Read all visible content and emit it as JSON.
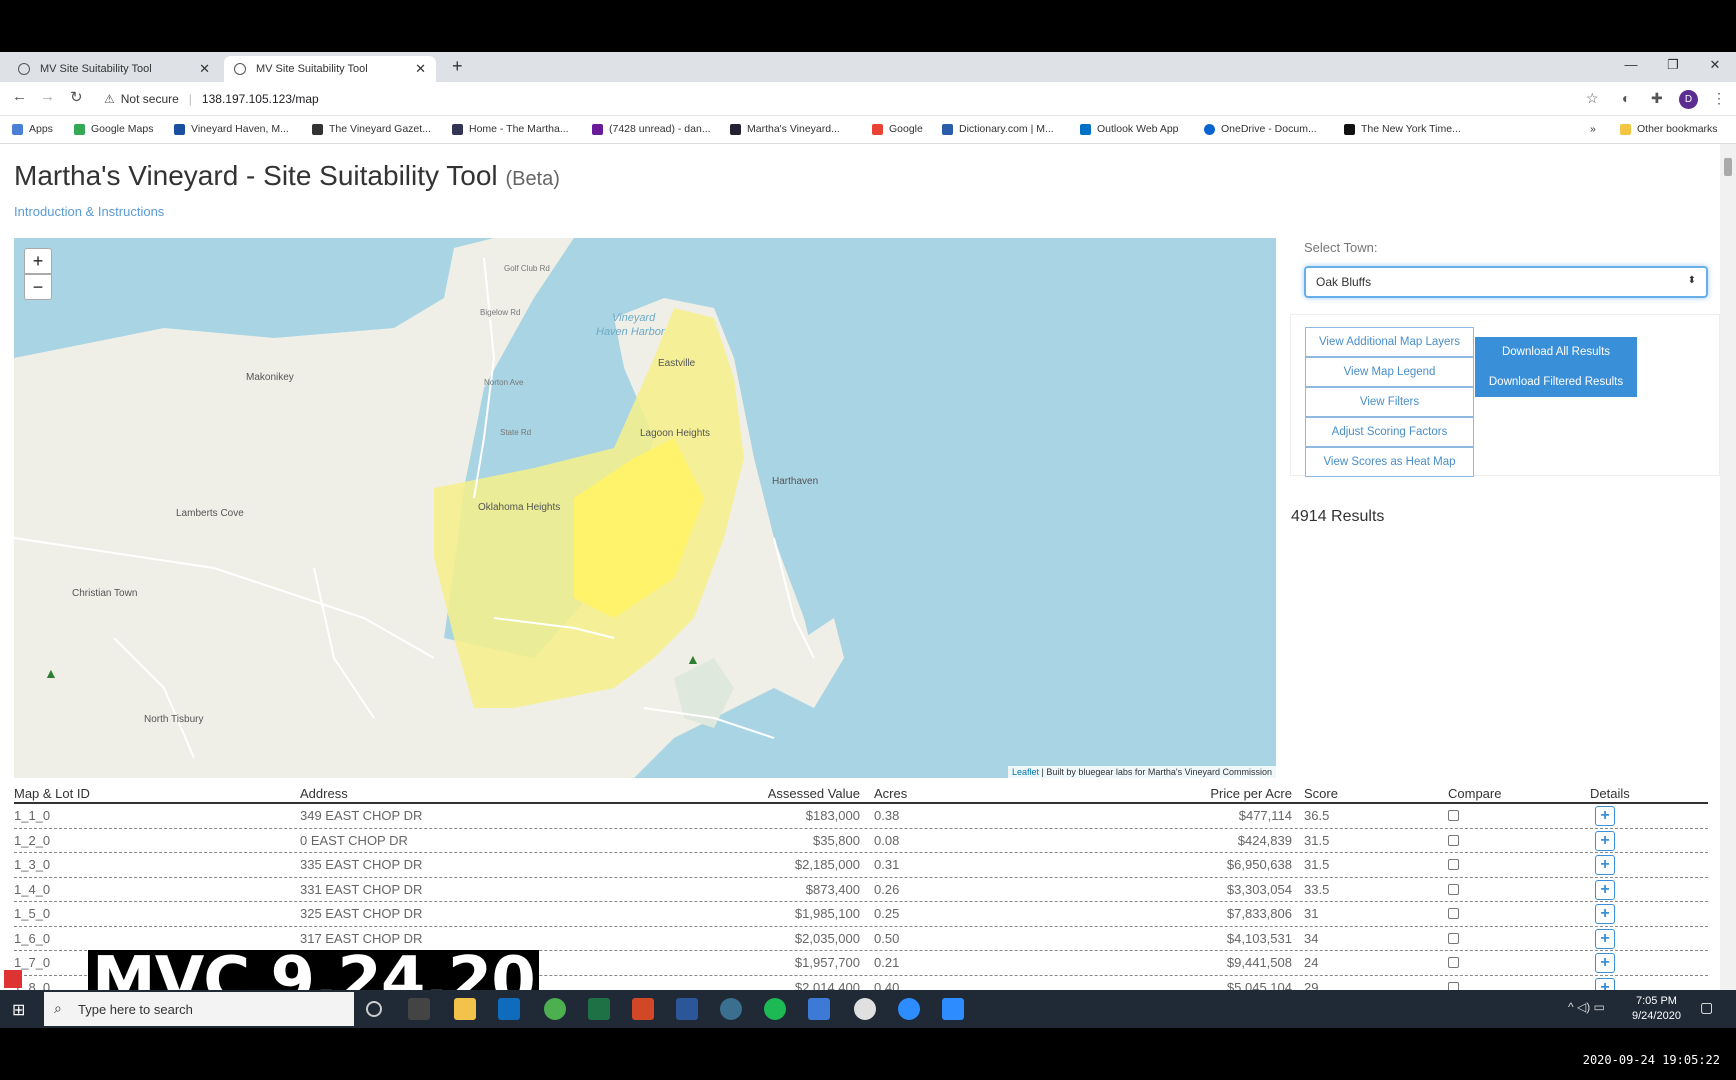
{
  "browser": {
    "tabs": [
      {
        "label": "MV Site Suitability Tool"
      },
      {
        "label": "MV Site Suitability Tool"
      }
    ],
    "security": "Not secure",
    "url": "138.197.105.123/map",
    "profile_initial": "D",
    "bookmarks": [
      "Apps",
      "Google Maps",
      "Vineyard Haven, M...",
      "The Vineyard Gazet...",
      "Home - The Martha...",
      "(7428 unread) - dan...",
      "Martha's Vineyard...",
      "Google",
      "Dictionary.com | M...",
      "Outlook Web App",
      "OneDrive - Docum...",
      "The New York Time..."
    ],
    "other_bookmarks": "Other bookmarks",
    "more": "»"
  },
  "page": {
    "title": "Martha's Vineyard - Site Suitability Tool",
    "beta": "(Beta)",
    "intro_link": "Introduction & Instructions"
  },
  "map": {
    "zoom_in": "+",
    "zoom_out": "−",
    "attribution_link": "Leaflet",
    "attribution_text": "| Built by bluegear labs for Martha's Vineyard Commission",
    "labels": {
      "makonikey": "Makonikey",
      "lamberts_cove": "Lamberts Cove",
      "christian_town": "Christian Town",
      "north_tisbury": "North Tisbury",
      "oklahoma_heights": "Oklahoma Heights",
      "harthaven": "Harthaven",
      "vh_harbor_1": "Vineyard",
      "vh_harbor_2": "Haven Harbor",
      "eastville": "Eastville",
      "lagoon": "Lagoon Heights",
      "bigelow": "Bigelow Rd",
      "norton": "Norton Ave",
      "golf_club": "Golf Club Rd",
      "state_rd": "State Rd"
    }
  },
  "panel": {
    "town_label": "Select Town:",
    "town_value": "Oak Bluffs",
    "view_buttons": [
      "View Additional Map Layers",
      "View Map Legend",
      "View Filters",
      "Adjust Scoring Factors",
      "View Scores as Heat Map"
    ],
    "download_all": "Download All Results",
    "download_filtered": "Download Filtered Results",
    "results": "4914 Results"
  },
  "table": {
    "headers": {
      "id": "Map & Lot ID",
      "address": "Address",
      "value": "Assessed Value",
      "acres": "Acres",
      "ppa": "Price per Acre",
      "score": "Score",
      "compare": "Compare",
      "details": "Details"
    },
    "rows": [
      {
        "id": "1_1_0",
        "address": "349 EAST CHOP DR",
        "value": "$183,000",
        "acres": "0.38",
        "ppa": "$477,114",
        "score": "36.5"
      },
      {
        "id": "1_2_0",
        "address": "0 EAST CHOP DR",
        "value": "$35,800",
        "acres": "0.08",
        "ppa": "$424,839",
        "score": "31.5"
      },
      {
        "id": "1_3_0",
        "address": "335 EAST CHOP DR",
        "value": "$2,185,000",
        "acres": "0.31",
        "ppa": "$6,950,638",
        "score": "31.5"
      },
      {
        "id": "1_4_0",
        "address": "331 EAST CHOP DR",
        "value": "$873,400",
        "acres": "0.26",
        "ppa": "$3,303,054",
        "score": "33.5"
      },
      {
        "id": "1_5_0",
        "address": "325 EAST CHOP DR",
        "value": "$1,985,100",
        "acres": "0.25",
        "ppa": "$7,833,806",
        "score": "31"
      },
      {
        "id": "1_6_0",
        "address": "317 EAST CHOP DR",
        "value": "$2,035,000",
        "acres": "0.50",
        "ppa": "$4,103,531",
        "score": "34"
      },
      {
        "id": "1_7_0",
        "address": "",
        "value": "$1,957,700",
        "acres": "0.21",
        "ppa": "$9,441,508",
        "score": "24"
      },
      {
        "id": "1_8_0",
        "address": "",
        "value": "$2,014,400",
        "acres": "0.40",
        "ppa": "$5,045,104",
        "score": "29"
      }
    ],
    "details_symbol": "+"
  },
  "taskbar": {
    "search_placeholder": "Type here to search",
    "time": "7:05 PM",
    "date": "9/24/2020"
  },
  "overlay": {
    "caption": "MVC 9.24.20",
    "timestamp": "2020-09-24 19:05:22"
  },
  "colors": {
    "accent": "#3a8fd9",
    "water": "#a9d4e4",
    "highlight": "#fff36b"
  }
}
